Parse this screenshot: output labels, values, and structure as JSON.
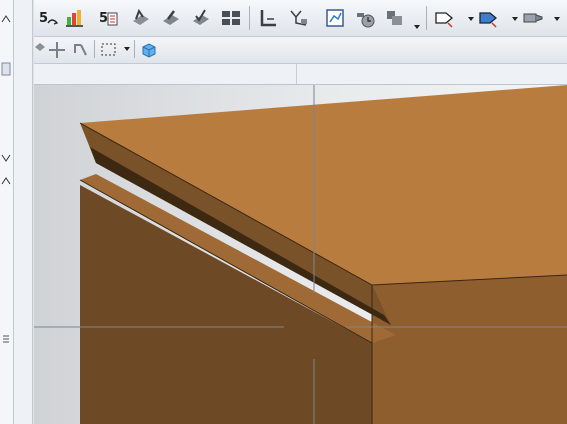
{
  "toolbar_top": {
    "buttons": [
      {
        "name": "sketch-icon"
      },
      {
        "name": "feature-manager-icon"
      },
      {
        "name": "properties-icon"
      },
      {
        "name": "mate-icon"
      },
      {
        "name": "insert-component-icon"
      },
      {
        "name": "check-icon"
      },
      {
        "name": "layout-icon"
      },
      {
        "name": "dimension-icon"
      },
      {
        "name": "smart-mate-icon"
      },
      {
        "name": "drawing-view-icon"
      },
      {
        "name": "clock-icon"
      },
      {
        "name": "pattern-icon"
      },
      {
        "name": "tube-icon"
      },
      {
        "name": "pipe-icon"
      },
      {
        "name": "nozzle-icon"
      }
    ]
  },
  "toolbar_second": {
    "buttons": [
      {
        "name": "snap-icon"
      },
      {
        "name": "move-icon"
      },
      {
        "name": "rotate-icon"
      },
      {
        "name": "selection-box-icon"
      },
      {
        "name": "view-cube-icon"
      }
    ]
  },
  "left_panel": {
    "buttons": [
      {
        "name": "collapse-icon"
      },
      {
        "name": "panel-icon"
      },
      {
        "name": "expand-icon"
      },
      {
        "name": "tab-icon"
      },
      {
        "name": "resize-handle-icon"
      }
    ]
  },
  "viewport": {
    "model": "3d-box-with-chamfer-edge",
    "colors": {
      "top_face": "#b97c3f",
      "front_face": "#6d4a25",
      "right_face": "#8e5e2f",
      "edge_highlight": "#a06a36",
      "groove": "#3d2812",
      "crosshair": "#7c8591"
    }
  }
}
